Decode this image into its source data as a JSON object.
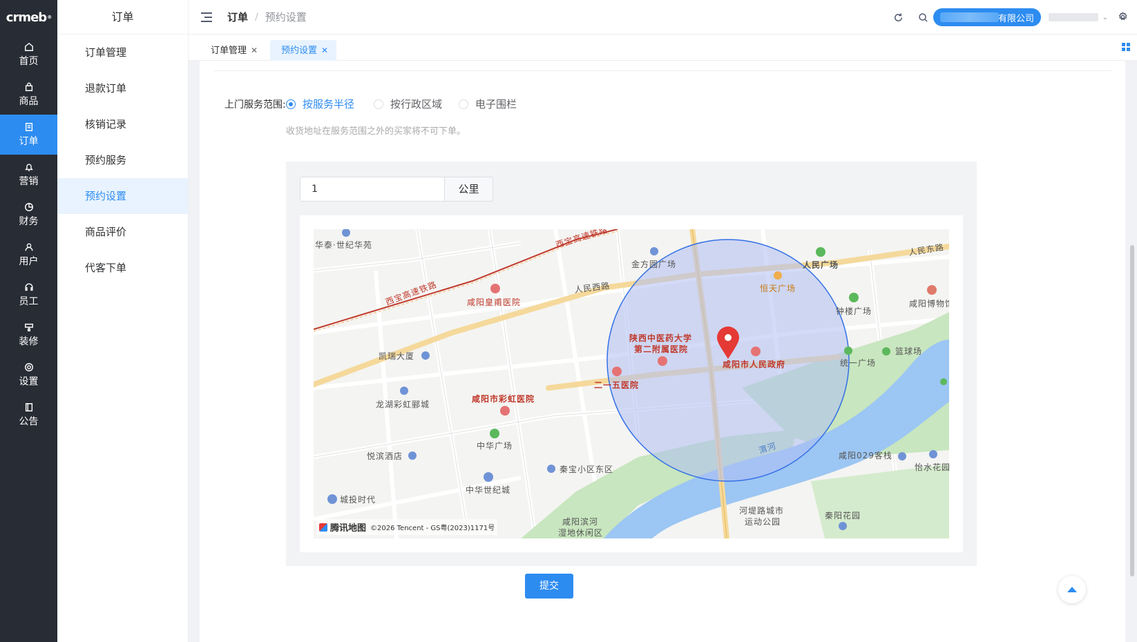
{
  "nav": {
    "logo": "crmeb",
    "items": [
      {
        "label": "首页",
        "icon": "home-icon"
      },
      {
        "label": "商品",
        "icon": "bag-icon"
      },
      {
        "label": "订单",
        "icon": "order-icon",
        "active": true
      },
      {
        "label": "营销",
        "icon": "bell-icon"
      },
      {
        "label": "财务",
        "icon": "pie-icon"
      },
      {
        "label": "用户",
        "icon": "user-icon"
      },
      {
        "label": "员工",
        "icon": "headset-icon"
      },
      {
        "label": "装修",
        "icon": "paint-icon"
      },
      {
        "label": "设置",
        "icon": "gear-icon"
      },
      {
        "label": "公告",
        "icon": "notice-icon"
      }
    ]
  },
  "submenu": {
    "title": "订单",
    "items": [
      "订单管理",
      "退款订单",
      "核销记录",
      "预约服务",
      "预约设置",
      "商品评价",
      "代客下单"
    ],
    "active_index": 4
  },
  "header": {
    "breadcrumb_root": "订单",
    "breadcrumb_sep": "/",
    "breadcrumb_current": "预约设置",
    "company_suffix": "有限公司"
  },
  "tabs": [
    {
      "label": "订单管理",
      "close": "✕"
    },
    {
      "label": "预约设置",
      "close": "✕",
      "active": true
    }
  ],
  "form": {
    "label": "上门服务范围:",
    "options": [
      "按服务半径",
      "按行政区域",
      "电子围栏"
    ],
    "selected_index": 0,
    "hint": "收货地址在服务范围之外的买家将不可下单。",
    "radius_value": "1",
    "radius_unit": "公里",
    "submit": "提交"
  },
  "map": {
    "provider": "腾讯地图",
    "copyright": "©2026 Tencent - GS粤(2023)1171号",
    "labels": {
      "l1": "华泰·世纪华苑",
      "l2": "西宝高速铁路",
      "l3": "西宝高速铁路",
      "l4": "人民西路",
      "l5": "金方圆广场",
      "l6": "人民广场",
      "l7": "人民东路",
      "l8": "恒天广场",
      "l9": "咸阳博物馆",
      "l10": "钟楼广场",
      "l11": "咸阳皇甫医院",
      "l12": "陕西中医药大学",
      "l13": "第二附属医院",
      "l14": "咸阳市人民政府",
      "l15": "篮球场",
      "l16": "统一广场",
      "l17": "凯瑞大厦",
      "l18": "二一五医院",
      "l19": "龙湖彩虹郦城",
      "l20": "咸阳市彩虹医院",
      "l21": "中华广场",
      "l22": "渭河",
      "l23": "悦滨酒店",
      "l24": "秦宝小区东区",
      "l25": "咸阳029客栈",
      "l26": "怡水花园",
      "l27": "中华世纪城",
      "l28": "城投时代",
      "l29": "河堤路城市",
      "l30": "运动公园",
      "l31": "秦阳花园",
      "l32": "咸阳滨河",
      "l33": "湿地休闲区"
    }
  },
  "colors": {
    "primary": "#2d8cf0",
    "nav_bg": "#282c34",
    "circle_fill": "#aebdf2",
    "circle_stroke": "#3370e6",
    "river": "#9cc6f3",
    "park": "#c8e6bf",
    "pin": "#e53935"
  }
}
